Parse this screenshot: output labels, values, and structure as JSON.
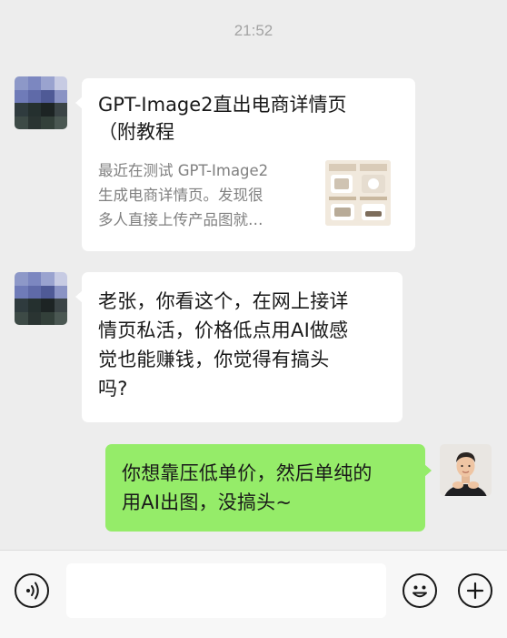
{
  "chat": {
    "timestamp": "21:52",
    "messages": [
      {
        "side": "left",
        "type": "link_card",
        "title_line1": "GPT-Image2直出电商详情页",
        "title_line2": "（附教程",
        "desc_lines": [
          "最近在测试 GPT-Image2",
          "生成电商详情页。发现很",
          "多人直接上传产品图就…"
        ]
      },
      {
        "side": "left",
        "type": "text",
        "lines": [
          "老张，你看这个，在网上接详",
          "情页私活，价格低点用AI做感",
          "觉也能赚钱，你觉得有搞头",
          "吗?"
        ]
      },
      {
        "side": "right",
        "type": "text",
        "lines": [
          "你想靠压低单价，然后单纯的",
          "用AI出图，没搞头~"
        ]
      }
    ]
  },
  "input_bar": {
    "voice_icon": "voice-icon",
    "emoji_icon": "emoji-icon",
    "plus_icon": "plus-icon",
    "placeholder": ""
  },
  "colors": {
    "background": "#ededed",
    "bubble_self": "#95ec69",
    "bubble_other": "#ffffff"
  }
}
